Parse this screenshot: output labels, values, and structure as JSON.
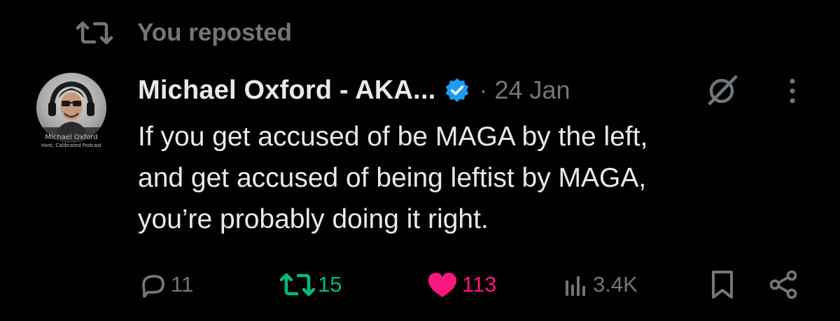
{
  "repost_header": {
    "label": "You reposted",
    "icon": "repost-icon"
  },
  "author": {
    "display_name": "Michael Oxford - AKA...",
    "verified": true,
    "avatar_caption_name": "Michael Oxford",
    "avatar_caption_sub": "Host, Calibrated Podcast",
    "separator": "·",
    "date": "24 Jan"
  },
  "post": {
    "lines": [
      "If you get accused of be MAGA by the left,",
      "and get accused of being leftist by MAGA,",
      "you’re probably doing it right."
    ]
  },
  "actions": {
    "replies": "11",
    "reposts": "15",
    "likes": "113",
    "views": "3.4K",
    "reply_icon": "comment-icon",
    "repost_icon": "repost-icon",
    "like_icon": "heart-icon",
    "views_icon": "bar-chart-icon",
    "bookmark_icon": "bookmark-icon",
    "share_icon": "share-icon"
  },
  "icons": {
    "grok": "grok-icon",
    "more": "more-icon"
  },
  "colors": {
    "background": "#000000",
    "primary_text": "#e7e9ea",
    "secondary_text": "#71767b",
    "verified_blue": "#1d9bf0",
    "repost_green": "#00ba7c",
    "like_pink": "#f91880"
  }
}
